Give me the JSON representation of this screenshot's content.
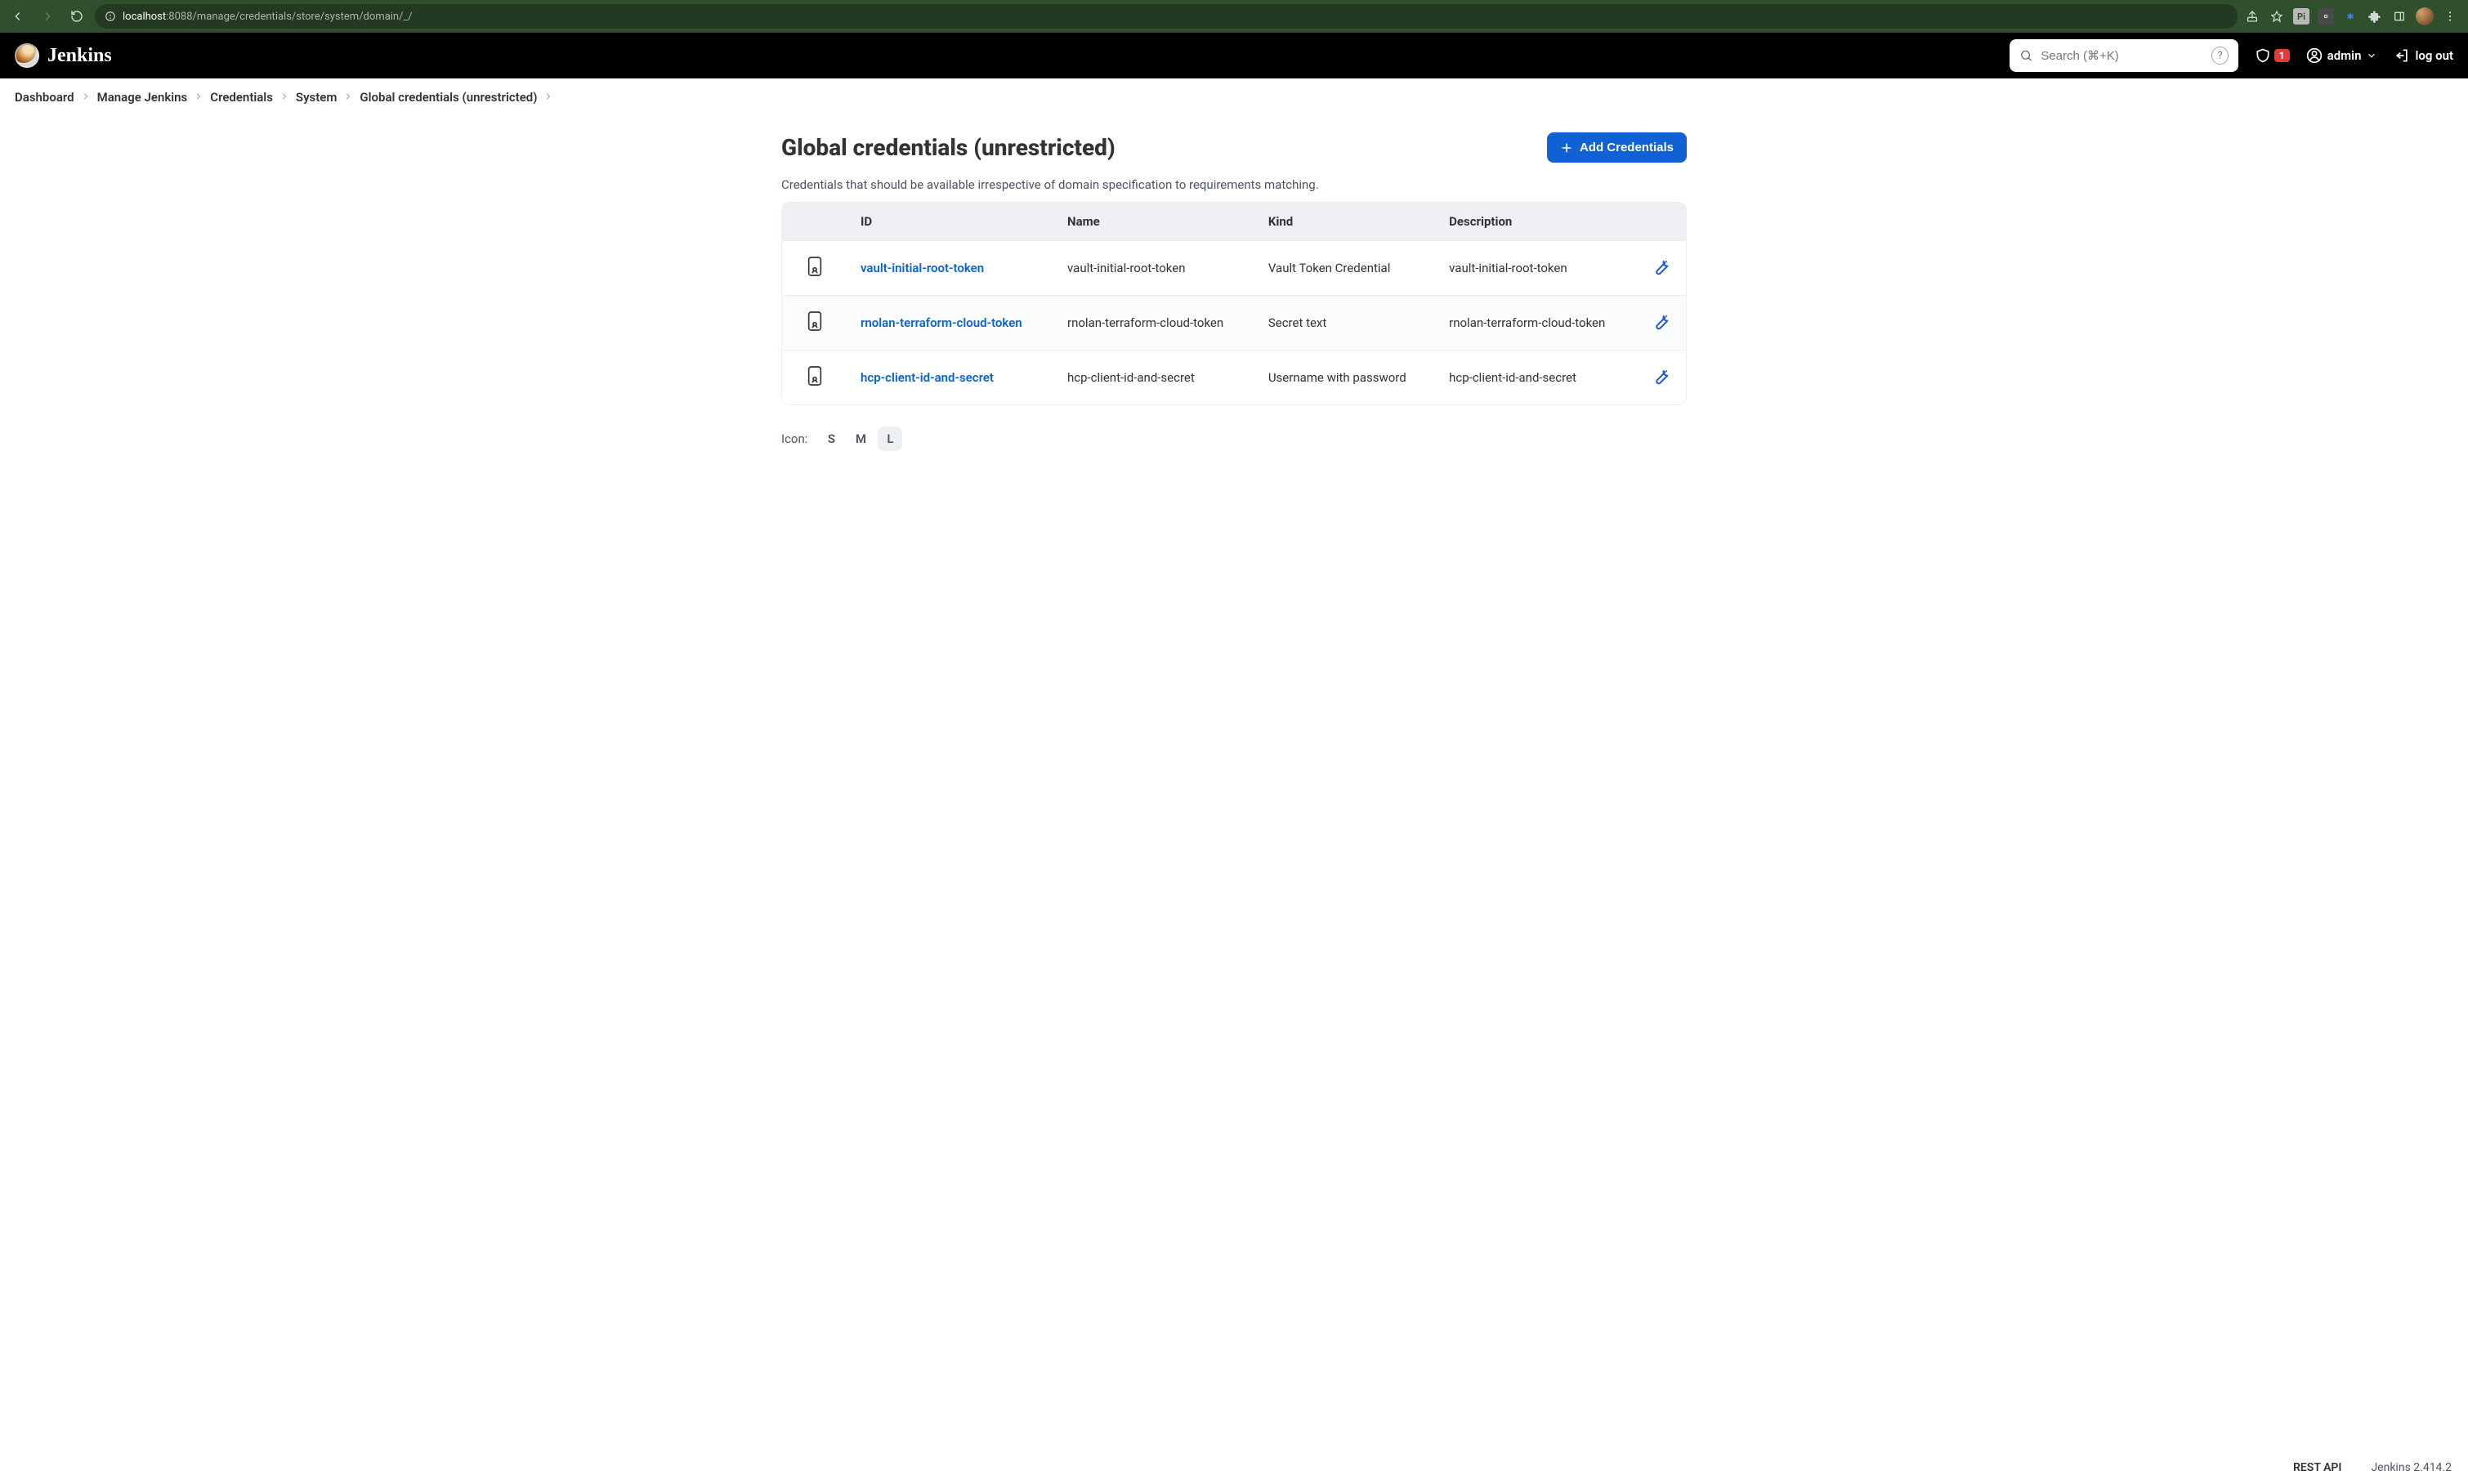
{
  "browser": {
    "url_host": "localhost",
    "url_port_path": ":8088/manage/credentials/store/system/domain/_/"
  },
  "header": {
    "brand": "Jenkins",
    "search_placeholder": "Search (⌘+K)",
    "alert_count": "1",
    "user": "admin",
    "logout": "log out"
  },
  "crumbs": [
    "Dashboard",
    "Manage Jenkins",
    "Credentials",
    "System",
    "Global credentials (unrestricted)"
  ],
  "page": {
    "title": "Global credentials (unrestricted)",
    "add_button": "Add Credentials",
    "description": "Credentials that should be available irrespective of domain specification to requirements matching."
  },
  "table": {
    "columns": [
      "",
      "ID",
      "Name",
      "Kind",
      "Description",
      ""
    ],
    "rows": [
      {
        "id": "vault-initial-root-token",
        "name": "vault-initial-root-token",
        "kind": "Vault Token Credential",
        "desc": "vault-initial-root-token"
      },
      {
        "id": "rnolan-terraform-cloud-token",
        "name": "rnolan-terraform-cloud-token",
        "kind": "Secret text",
        "desc": "rnolan-terraform-cloud-token"
      },
      {
        "id": "hcp-client-id-and-secret",
        "name": "hcp-client-id-and-secret",
        "kind": "Username with password",
        "desc": "hcp-client-id-and-secret"
      }
    ]
  },
  "icon_size": {
    "label": "Icon:",
    "options": [
      "S",
      "M",
      "L"
    ],
    "active": "L"
  },
  "footer": {
    "api": "REST API",
    "version": "Jenkins 2.414.2"
  }
}
